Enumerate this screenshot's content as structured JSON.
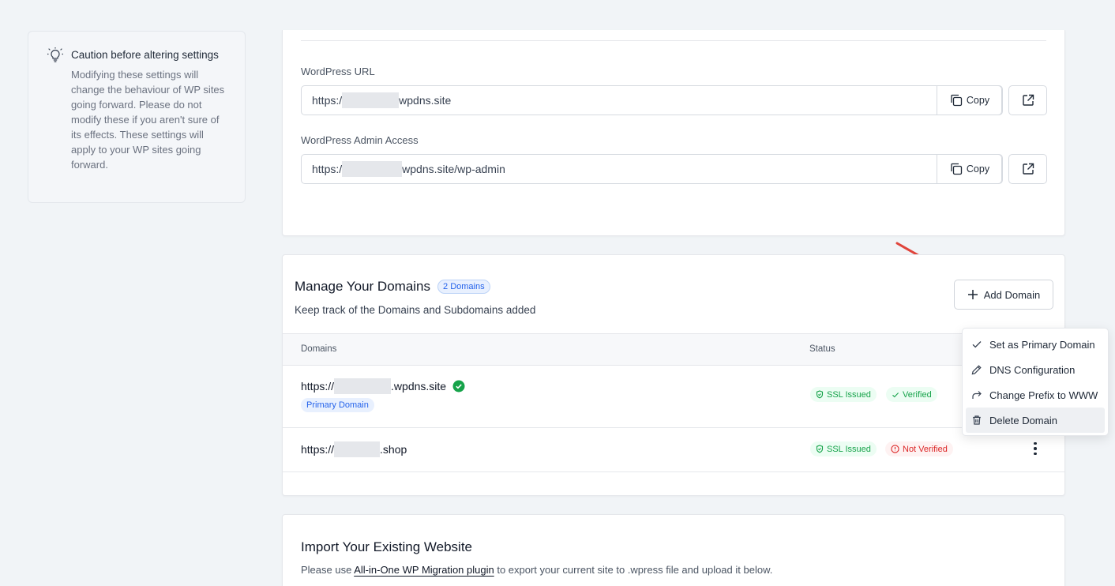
{
  "caution": {
    "title": "Caution before altering settings",
    "body": "Modifying these settings will change the behaviour of WP sites going forward. Please do not modify these if you aren't sure of its effects. These settings will apply to your WP sites going forward.",
    "icon": "lightbulb-icon"
  },
  "site": {
    "wp_url": {
      "label": "WordPress URL",
      "prefix": "https:/",
      "suffix": "wpdns.site",
      "copy_label": "Copy"
    },
    "wp_admin": {
      "label": "WordPress Admin Access",
      "prefix": "https:/",
      "suffix": "wpdns.site/wp-admin",
      "copy_label": "Copy"
    }
  },
  "domains": {
    "title": "Manage Your Domains",
    "count_badge": "2 Domains",
    "subtitle": "Keep track of the Domains and Subdomains added",
    "add_button": "Add Domain",
    "columns": {
      "domains": "Domains",
      "status": "Status"
    },
    "rows": [
      {
        "prefix": "https://",
        "suffix": ".wpdns.site",
        "primary_badge": "Primary Domain",
        "ssl": "SSL Issued",
        "verification": "Verified"
      },
      {
        "prefix": "https://",
        "suffix": ".shop",
        "ssl": "SSL Issued",
        "verification": "Not Verified"
      }
    ],
    "menu": [
      {
        "label": "Set as Primary Domain",
        "icon": "check-icon"
      },
      {
        "label": "DNS Configuration",
        "icon": "pencil-icon"
      },
      {
        "label": "Change Prefix to WWW",
        "icon": "redirect-arrow-icon"
      },
      {
        "label": "Delete Domain",
        "icon": "trash-icon"
      }
    ]
  },
  "import": {
    "title": "Import Your Existing Website",
    "text_before": "Please use ",
    "link": "All-in-One WP Migration plugin",
    "text_after": " to export your current site to .wpress file and upload it below."
  },
  "colors": {
    "background": "#f1f4f7",
    "accent_blue": "#2563eb",
    "success_green": "#16a34a",
    "danger_red": "#dc2626",
    "annotation_arrow": "#e0443b"
  }
}
